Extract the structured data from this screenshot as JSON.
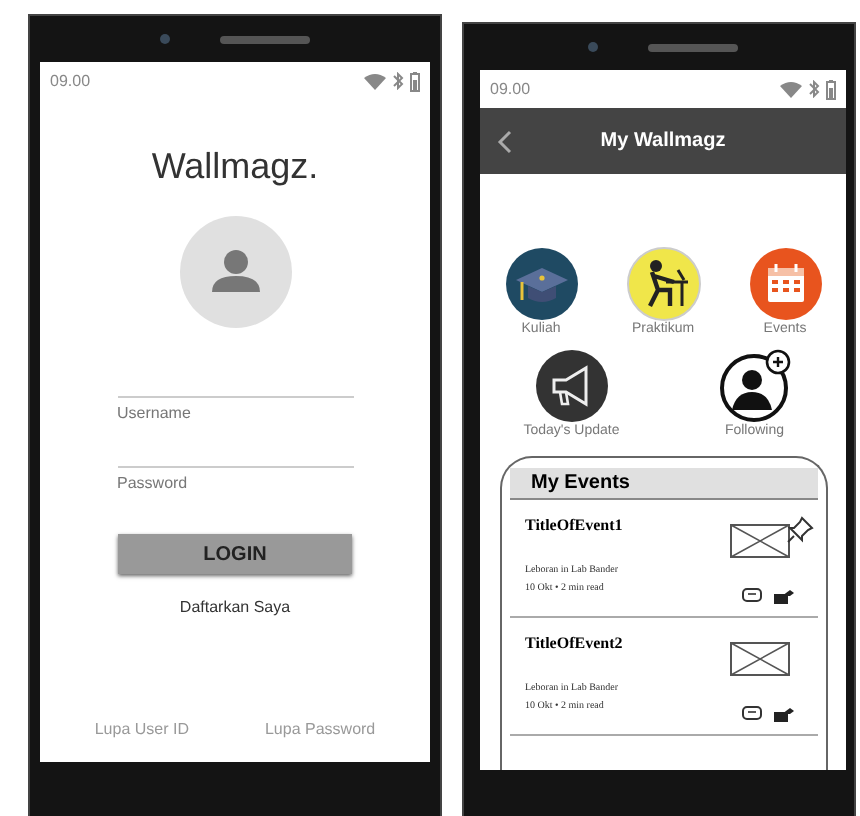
{
  "left_screen": {
    "status_bar": {
      "time": "09.00"
    },
    "app_title": "Wallmagz.",
    "fields": [
      {
        "placeholder": "Username"
      },
      {
        "placeholder": "Password"
      }
    ],
    "login_button": "LOGIN",
    "register_link": "Daftarkan Saya",
    "footer_links": [
      "Lupa User ID",
      "Lupa Password"
    ]
  },
  "right_screen": {
    "status_bar": {
      "time": "09.00"
    },
    "header": {
      "title": "My Wallmagz"
    },
    "menu_rows": [
      {
        "items": [
          {
            "label": "Kuliah",
            "kind": "cap"
          },
          {
            "label": "Praktikum",
            "kind": "desk"
          },
          {
            "label": "Events",
            "kind": "calendar"
          }
        ]
      },
      {
        "items": [
          {
            "label": "Today's Update",
            "kind": "megaphone"
          },
          {
            "label": "Following",
            "kind": "follow"
          }
        ]
      }
    ],
    "events": {
      "title": "My Events",
      "items": [
        {
          "title": "TitleOfEvent1",
          "subtitle": "Leboran in Lab Bander",
          "meta": "10 Okt • 2 min read",
          "pinned": true
        },
        {
          "title": "TitleOfEvent2",
          "subtitle": "Leboran in Lab Bander",
          "meta": "10 Okt • 2 min read",
          "pinned": false
        }
      ]
    }
  }
}
